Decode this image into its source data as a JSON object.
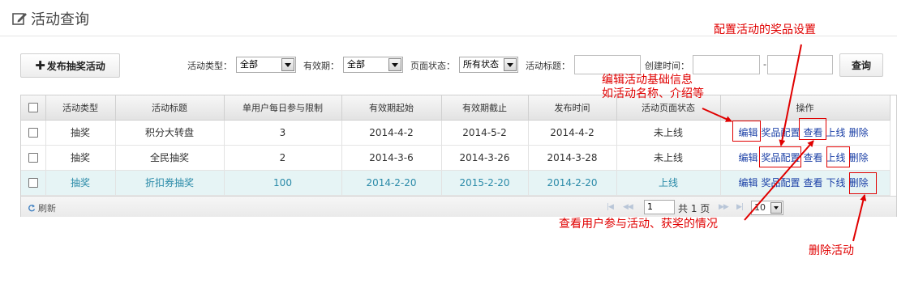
{
  "page": {
    "title": "活动查询"
  },
  "toolbar": {
    "publish_label": "发布抽奖活动",
    "query_label": "查询",
    "filters": {
      "activity_type": {
        "label": "活动类型：",
        "value": "全部"
      },
      "validity": {
        "label": "有效期：",
        "value": "全部"
      },
      "page_status": {
        "label": "页面状态：",
        "value": "所有状态"
      },
      "activity_title": {
        "label": "活动标题：",
        "value": ""
      },
      "created_time": {
        "label": "创建时间：",
        "from": "",
        "separator": "-",
        "to": ""
      }
    }
  },
  "grid": {
    "columns": [
      "活动类型",
      "活动标题",
      "单用户每日参与限制",
      "有效期起始",
      "有效期截止",
      "发布时间",
      "活动页面状态",
      "操作"
    ],
    "rows": [
      {
        "type": "抽奖",
        "title": "积分大转盘",
        "limit": "3",
        "start": "2014-4-2",
        "end": "2014-5-2",
        "publish": "2014-4-2",
        "status": "未上线",
        "ops": [
          "编辑",
          "奖品配置",
          "查看",
          "上线",
          "删除"
        ]
      },
      {
        "type": "抽奖",
        "title": "全民抽奖",
        "limit": "2",
        "start": "2014-3-6",
        "end": "2014-3-26",
        "publish": "2014-3-28",
        "status": "未上线",
        "ops": [
          "编辑",
          "奖品配置",
          "查看",
          "上线",
          "删除"
        ]
      },
      {
        "type": "抽奖",
        "title": "折扣券抽奖",
        "limit": "100",
        "start": "2014-2-20",
        "end": "2015-2-20",
        "publish": "2014-2-20",
        "status": "上线",
        "ops": [
          "编辑",
          "奖品配置",
          "查看",
          "下线",
          "删除"
        ]
      }
    ],
    "pager": {
      "refresh_label": "刷新",
      "page_value": "1",
      "total_text": "共 1 页",
      "page_size": "10"
    }
  },
  "annotations": {
    "prize_config": "配置活动的奖品设置",
    "edit_line1": "编辑活动基础信息",
    "edit_line2": "如活动名称、介绍等",
    "view": "查看用户参与活动、获奖的情况",
    "delete": "删除活动"
  },
  "colors": {
    "annotation": "#e00000",
    "link": "#1a3fa6",
    "selected_row_bg": "#e6f4f5",
    "selected_row_text": "#2a8aa8"
  }
}
